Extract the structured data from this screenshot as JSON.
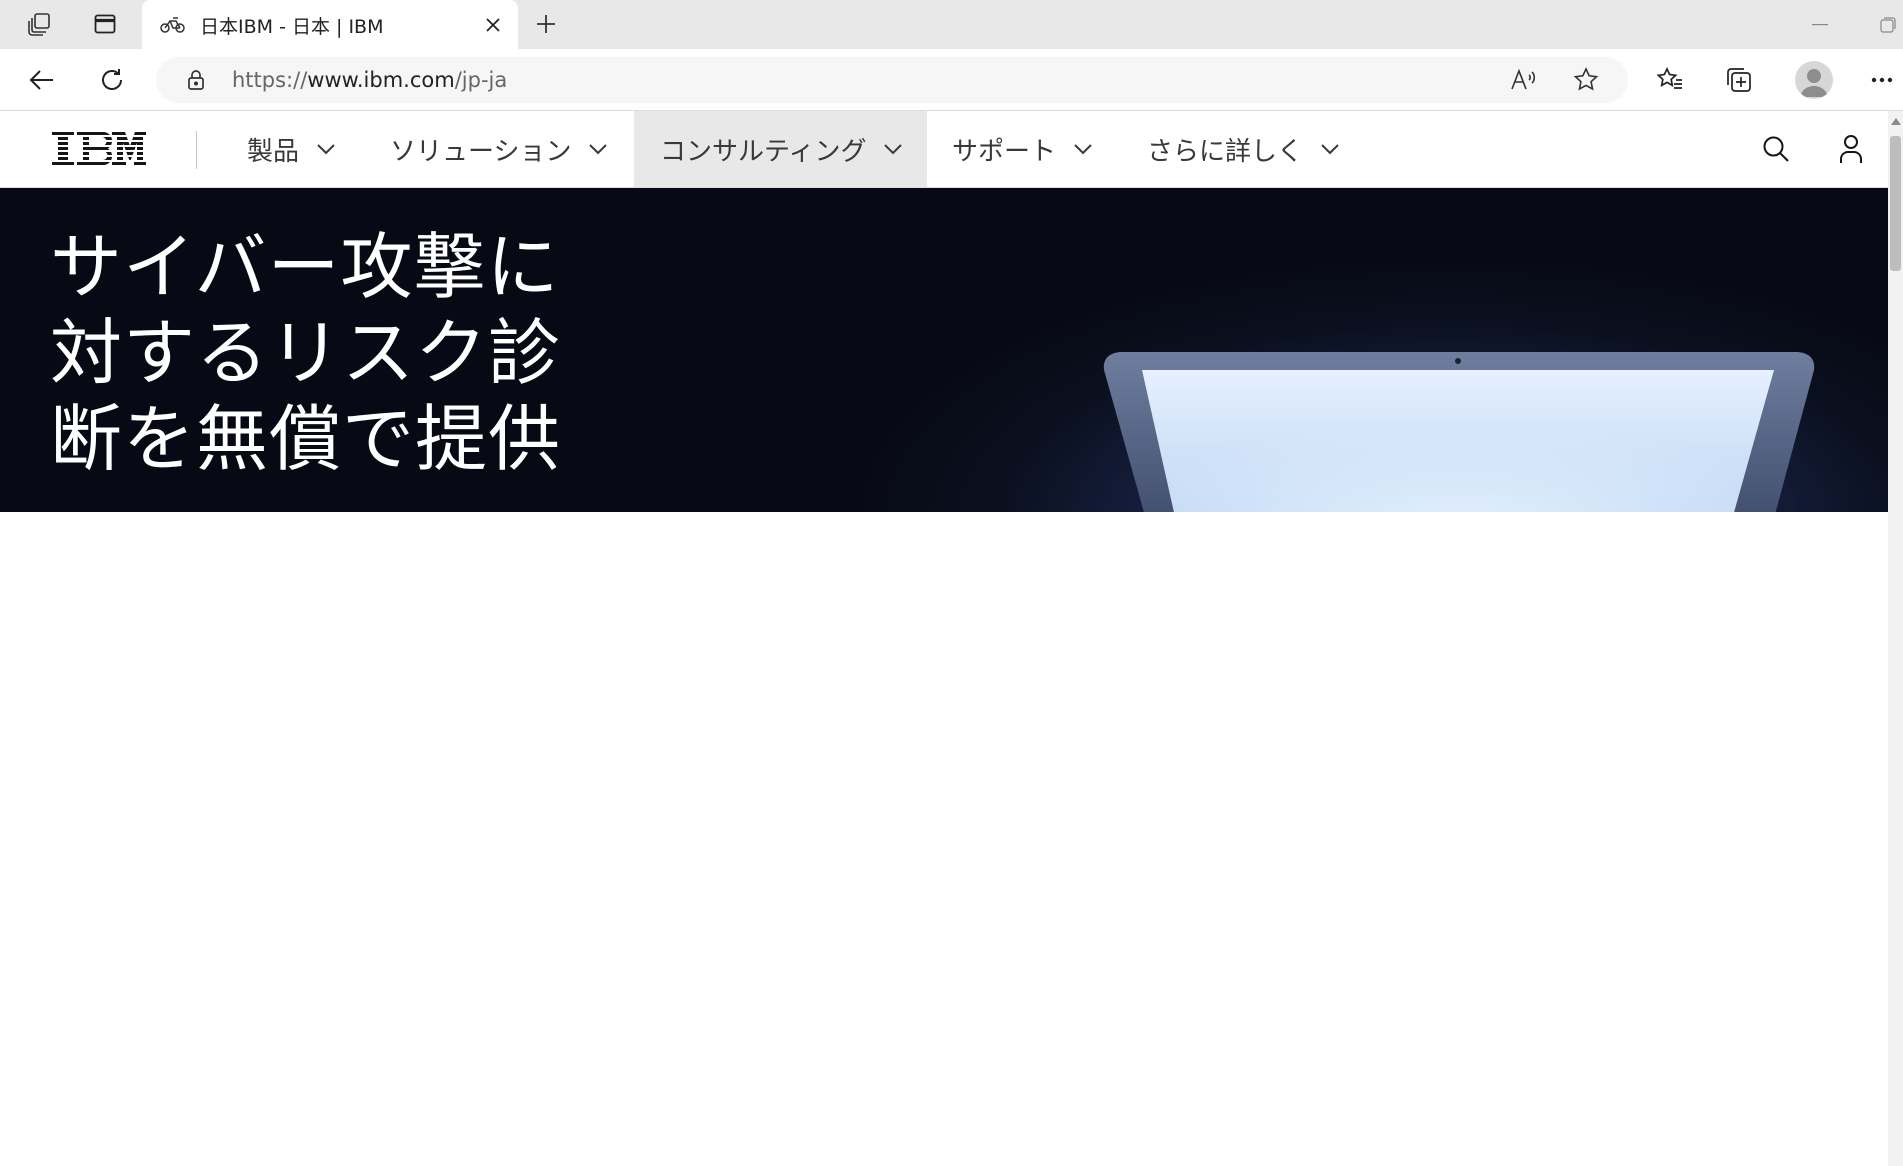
{
  "browser": {
    "tab": {
      "title": "日本IBM - 日本 | IBM"
    },
    "address": {
      "protocol": "https://",
      "host": "www.ibm.com",
      "path": "/jp-ja"
    }
  },
  "site_nav": {
    "logo": "IBM",
    "items": [
      {
        "label": "製品",
        "active": false
      },
      {
        "label": "ソリューション",
        "active": false
      },
      {
        "label": "コンサルティング",
        "active": true
      },
      {
        "label": "サポート",
        "active": false
      },
      {
        "label": "さらに詳しく",
        "active": false
      }
    ]
  },
  "hero": {
    "title_lines": [
      "サイバー攻撃に",
      "対するリスク診",
      "断を無償で提供"
    ]
  },
  "colors": {
    "hero_bg": "#0b1020",
    "nav_active_bg": "#e8e8e8",
    "text_primary": "#161616"
  }
}
